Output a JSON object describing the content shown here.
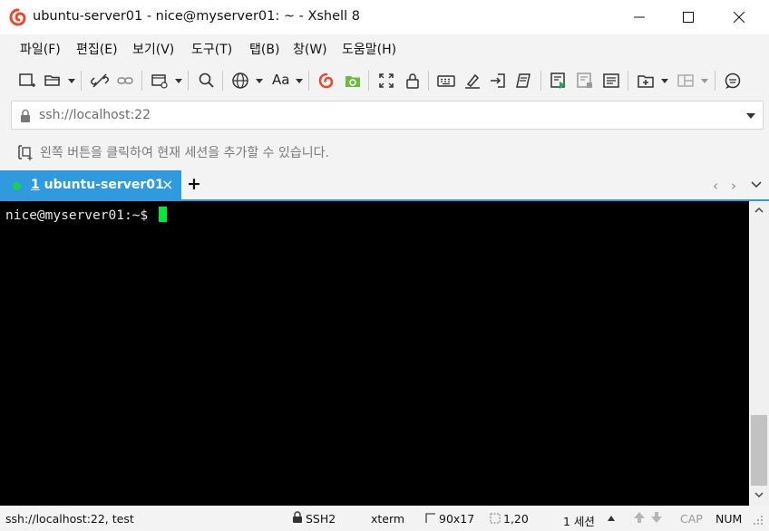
{
  "window": {
    "title": "ubuntu-server01 - nice@myserver01: ~ - Xshell 8",
    "brand_color": "#e64a2e"
  },
  "menu": [
    "파일(F)",
    "편집(E)",
    "보기(V)",
    "도구(T)",
    "탭(B)",
    "창(W)",
    "도움말(H)"
  ],
  "toolbar": {
    "font_label": "Aa",
    "icons": [
      "new-session-icon",
      "open-folder-icon",
      "disconnect-icon",
      "link-icon",
      "new-window-icon",
      "search-icon",
      "globe-icon",
      "font-icon",
      "xshell-icon",
      "xftp-icon",
      "fullscreen-icon",
      "lock-icon",
      "keyboard-icon",
      "highlight-icon",
      "compose-icon",
      "script-icon",
      "record-icon",
      "stop-record-icon",
      "notes-icon",
      "add-tab-icon",
      "layout-icon",
      "chat-icon"
    ]
  },
  "address": {
    "placeholder": "ssh://localhost:22"
  },
  "hint": {
    "text": "왼쪽 버튼을 클릭하여 현재 세션을 추가할 수 있습니다."
  },
  "tabs": {
    "active": {
      "number": "1",
      "label": "ubuntu-server01",
      "close": "×",
      "status_color": "#1ad14b",
      "tab_color": "#2f9bde"
    },
    "add": "+",
    "prev": "‹",
    "next": "›",
    "menu": "⌄"
  },
  "terminal": {
    "prompt": "nice@myserver01:~$",
    "cursor_color": "#00e83a"
  },
  "status": {
    "connection": "ssh://localhost:22, test",
    "protocol": "SSH2",
    "terminal_type": "xterm",
    "size": "90x17",
    "cursor_pos": "1,20",
    "sessions": "1 세션",
    "caps": "CAP",
    "num": "NUM"
  }
}
